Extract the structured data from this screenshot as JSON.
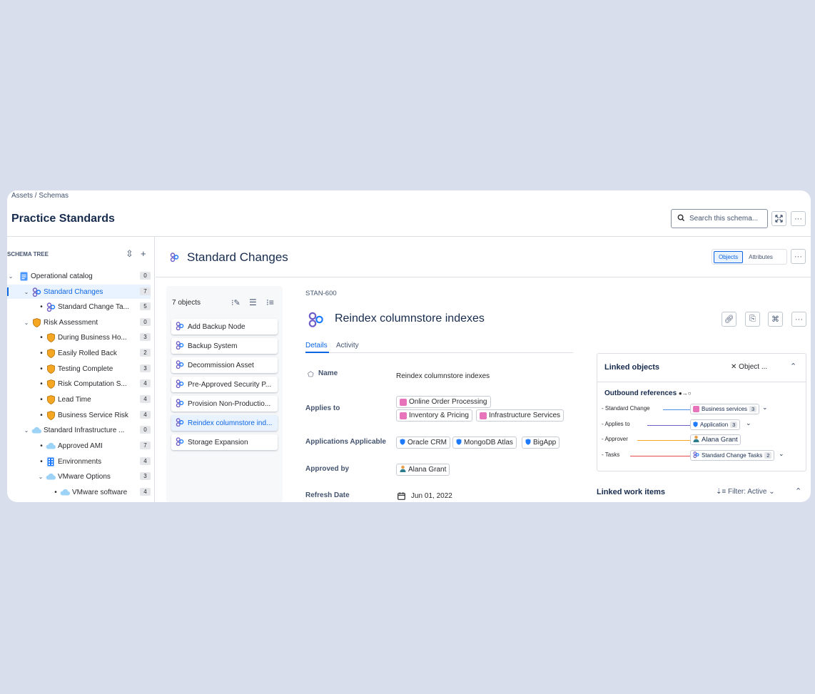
{
  "breadcrumb": {
    "assets": "Assets",
    "separator": "/",
    "schemas": "Schemas"
  },
  "page_title": "Practice Standards",
  "search": {
    "placeholder": "Search this schema..."
  },
  "sidebar": {
    "header": "SCHEMA TREE",
    "items": [
      {
        "label": "Operational catalog",
        "count": "0",
        "icon": "document-icon"
      },
      {
        "label": "Standard Changes",
        "count": "7",
        "icon": "object-type-icon",
        "selected": true
      },
      {
        "label": "Standard Change Ta...",
        "count": "5",
        "icon": "object-type-icon"
      },
      {
        "label": "Risk Assessment",
        "count": "0",
        "icon": "shield-icon"
      },
      {
        "label": "During Business Ho...",
        "count": "3",
        "icon": "shield-icon"
      },
      {
        "label": "Easily Rolled Back",
        "count": "2",
        "icon": "shield-icon"
      },
      {
        "label": "Testing Complete",
        "count": "3",
        "icon": "shield-icon"
      },
      {
        "label": "Risk Computation S...",
        "count": "4",
        "icon": "shield-icon"
      },
      {
        "label": "Lead Time",
        "count": "4",
        "icon": "shield-icon"
      },
      {
        "label": "Business Service Risk",
        "count": "4",
        "icon": "shield-icon"
      },
      {
        "label": "Standard Infrastructure ...",
        "count": "0",
        "icon": "cloud-icon"
      },
      {
        "label": "Approved AMI",
        "count": "7",
        "icon": "cloud-icon"
      },
      {
        "label": "Environments",
        "count": "4",
        "icon": "building-icon"
      },
      {
        "label": "VMware Options",
        "count": "3",
        "icon": "cloud-icon"
      },
      {
        "label": "VMware software",
        "count": "4",
        "icon": "cloud-icon"
      }
    ]
  },
  "main": {
    "title": "Standard Changes",
    "view_toggle": {
      "objects": "Objects",
      "attributes": "Attributes"
    }
  },
  "objects": {
    "count_label": "7 objects",
    "items": [
      "Add Backup Node",
      "Backup System",
      "Decommission Asset",
      "Pre-Approved Security P...",
      "Provision Non-Productio...",
      "Reindex columnstore ind...",
      "Storage Expansion"
    ]
  },
  "detail": {
    "key": "STAN-600",
    "title": "Reindex columnstore indexes",
    "tabs": {
      "details": "Details",
      "activity": "Activity"
    },
    "fields": {
      "name_label": "Name",
      "name_value": "Reindex columnstore indexes",
      "applies_label": "Applies to",
      "applies_values": [
        "Online Order Processing",
        "Inventory & Pricing",
        "Infrastructure Services"
      ],
      "apps_label": "Applications Applicable",
      "apps_values": [
        "Oracle CRM",
        "MongoDB Atlas",
        "BigApp"
      ],
      "approved_label": "Approved by",
      "approved_value": "Alana Grant",
      "refresh_label": "Refresh Date",
      "refresh_value": "Jun 01, 2022"
    }
  },
  "linked_objects": {
    "title": "Linked objects",
    "action": "Object ...",
    "outbound_title": "Outbound references",
    "refs": [
      {
        "label": "- Standard Change",
        "target": "Business services",
        "count": "3",
        "color": "#4a90e2"
      },
      {
        "label": "- Applies to",
        "target": "Application",
        "count": "3",
        "color": "#6e5dc6"
      },
      {
        "label": "- Approver",
        "target": "Alana Grant",
        "count": "",
        "color": "#f5a623"
      },
      {
        "label": "- Tasks",
        "target": "Standard Change Tasks",
        "count": "2",
        "color": "#e5484d"
      }
    ]
  },
  "linked_work": {
    "title": "Linked work items",
    "filter": "Filter: Active"
  }
}
